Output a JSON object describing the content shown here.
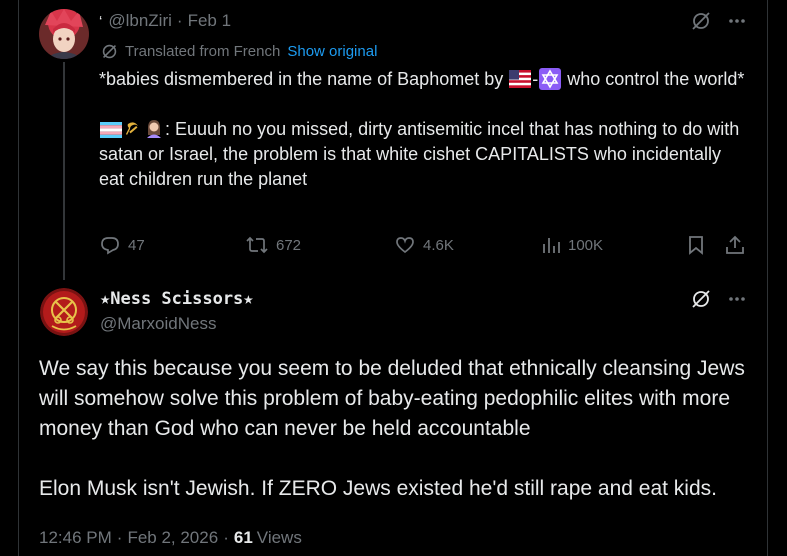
{
  "parent_tweet": {
    "handle_prefix": "‘",
    "handle": "@lbnZiri",
    "separator": "·",
    "date": "Feb 1",
    "translated_label": "Translated from French",
    "show_original_label": "Show original",
    "text_line1_before": "*babies dismembered in the name of Baphomet by ",
    "text_line1_dash": "-",
    "text_line1_after": " who control the world*",
    "text_para2_after_emoji": ": Euuuh no you missed, dirty antisemitic incel that has nothing to do with satan or Israel, the problem is that white cishet CAPITALISTS who incidentally eat children run the planet",
    "emojis": [
      "us-flag-emoji",
      "star-of-david-emoji",
      "transgender-flag-emoji",
      "hammer-sickle-emoji",
      "woman-emoji"
    ],
    "stats": {
      "replies": "47",
      "reposts": "672",
      "likes": "4.6K",
      "views": "100K"
    }
  },
  "main_tweet": {
    "name": "★Ness Scissors★",
    "handle": "@MarxoidNess",
    "paragraph1": "We say this because you seem to be deluded that ethnically cleansing Jews will somehow solve this problem of baby-eating pedophilic elites with more money than God who can never be held accountable",
    "paragraph2": "Elon Musk isn't Jewish. If ZERO Jews existed he'd still rape and eat kids.",
    "time": "12:46 PM",
    "separator": "·",
    "date": "Feb 2, 2026",
    "views_count": "61",
    "views_label": "Views"
  },
  "colors": {
    "background": "#000000",
    "text_primary": "#e7e9ea",
    "text_secondary": "#71767b",
    "link": "#1d9bf0",
    "border": "#2f3336"
  }
}
